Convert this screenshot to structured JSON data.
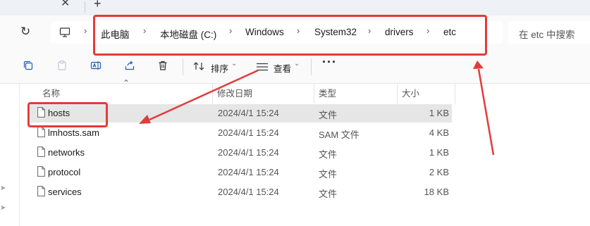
{
  "address": {
    "crumbs": [
      "此电脑",
      "本地磁盘 (C:)",
      "Windows",
      "System32",
      "drivers",
      "etc"
    ]
  },
  "search": {
    "placeholder": "在 etc 中搜索"
  },
  "toolbar": {
    "sort_label": "排序",
    "view_label": "查看"
  },
  "columns": {
    "name": "名称",
    "date": "修改日期",
    "type": "类型",
    "size": "大小"
  },
  "files": [
    {
      "name": "hosts",
      "date": "2024/4/1 15:24",
      "type": "文件",
      "size": "1 KB",
      "selected": true
    },
    {
      "name": "lmhosts.sam",
      "date": "2024/4/1 15:24",
      "type": "SAM 文件",
      "size": "4 KB"
    },
    {
      "name": "networks",
      "date": "2024/4/1 15:24",
      "type": "文件",
      "size": "1 KB"
    },
    {
      "name": "protocol",
      "date": "2024/4/1 15:24",
      "type": "文件",
      "size": "2 KB"
    },
    {
      "name": "services",
      "date": "2024/4/1 15:24",
      "type": "文件",
      "size": "18 KB"
    }
  ],
  "colors": {
    "annotation": "#e33b3b",
    "selection": "#e6e6e6",
    "accent": "#1f5fbf"
  },
  "icons": {
    "refresh": "refresh-icon",
    "computer": "computer-icon",
    "copy": "copy-icon",
    "paste": "paste-icon",
    "rename": "rename-icon",
    "share": "share-icon",
    "delete": "delete-icon",
    "sort": "sort-icon",
    "view": "view-icon",
    "more": "more-icon",
    "file": "file-icon"
  }
}
